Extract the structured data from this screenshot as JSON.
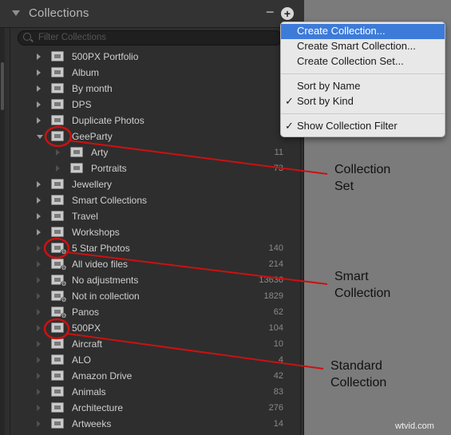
{
  "panel": {
    "title": "Collections",
    "minus_label": "−",
    "plus_label": "+",
    "filter_placeholder": "Filter Collections"
  },
  "rows": [
    {
      "label": "500PX Portfolio",
      "count": "",
      "kind": "set",
      "disclosure": "closed"
    },
    {
      "label": "Album",
      "count": "",
      "kind": "set",
      "disclosure": "closed"
    },
    {
      "label": "By month",
      "count": "",
      "kind": "set",
      "disclosure": "closed"
    },
    {
      "label": "DPS",
      "count": "",
      "kind": "set",
      "disclosure": "closed"
    },
    {
      "label": "Duplicate Photos",
      "count": "",
      "kind": "set",
      "disclosure": "closed"
    },
    {
      "label": "GeeParty",
      "count": "",
      "kind": "set",
      "disclosure": "open"
    },
    {
      "label": "Arty",
      "count": "11",
      "kind": "standard",
      "disclosure": "faint",
      "indent": 1
    },
    {
      "label": "Portraits",
      "count": "73",
      "kind": "standard",
      "disclosure": "faint",
      "indent": 1
    },
    {
      "label": "Jewellery",
      "count": "",
      "kind": "set",
      "disclosure": "closed"
    },
    {
      "label": "Smart Collections",
      "count": "",
      "kind": "set",
      "disclosure": "closed"
    },
    {
      "label": "Travel",
      "count": "",
      "kind": "set",
      "disclosure": "closed"
    },
    {
      "label": "Workshops",
      "count": "",
      "kind": "set",
      "disclosure": "closed"
    },
    {
      "label": "5 Star Photos",
      "count": "140",
      "kind": "smart",
      "disclosure": "faint"
    },
    {
      "label": "All video files",
      "count": "214",
      "kind": "smart",
      "disclosure": "faint"
    },
    {
      "label": "No adjustments",
      "count": "13636",
      "kind": "smart",
      "disclosure": "faint"
    },
    {
      "label": "Not in collection",
      "count": "1829",
      "kind": "smart",
      "disclosure": "faint"
    },
    {
      "label": "Panos",
      "count": "62",
      "kind": "smart",
      "disclosure": "faint"
    },
    {
      "label": "500PX",
      "count": "104",
      "kind": "standard",
      "disclosure": "faint"
    },
    {
      "label": "Aircraft",
      "count": "10",
      "kind": "standard",
      "disclosure": "faint"
    },
    {
      "label": "ALO",
      "count": "4",
      "kind": "standard",
      "disclosure": "faint"
    },
    {
      "label": "Amazon Drive",
      "count": "42",
      "kind": "standard",
      "disclosure": "faint"
    },
    {
      "label": "Animals",
      "count": "83",
      "kind": "standard",
      "disclosure": "faint"
    },
    {
      "label": "Architecture",
      "count": "276",
      "kind": "standard",
      "disclosure": "faint"
    },
    {
      "label": "Artweeks",
      "count": "14",
      "kind": "standard",
      "disclosure": "faint"
    }
  ],
  "menu": {
    "items": [
      {
        "label": "Create Collection...",
        "highlighted": true,
        "checked": false
      },
      {
        "label": "Create Smart Collection...",
        "highlighted": false,
        "checked": false
      },
      {
        "label": "Create Collection Set...",
        "highlighted": false,
        "checked": false
      },
      {
        "label": "Sort by Name",
        "highlighted": false,
        "checked": false
      },
      {
        "label": "Sort by Kind",
        "highlighted": false,
        "checked": true
      },
      {
        "label": "Show Collection Filter",
        "highlighted": false,
        "checked": true
      }
    ],
    "checkmark": "✓"
  },
  "annotations": {
    "collection_set": [
      "Collection",
      "Set"
    ],
    "smart_collection": [
      "Smart",
      "Collection"
    ],
    "standard_collection": [
      "Standard",
      "Collection"
    ],
    "color": "#cc1111"
  },
  "watermark": "wtvid.com"
}
